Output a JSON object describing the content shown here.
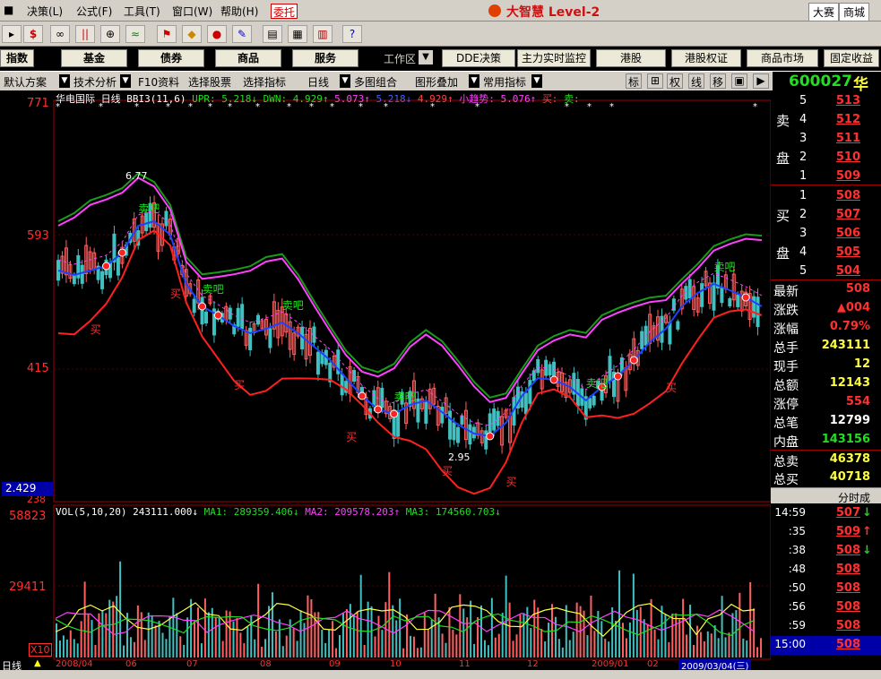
{
  "menu": {
    "items": [
      "决策(L)",
      "公式(F)",
      "工具(T)",
      "窗口(W)",
      "帮助(H)"
    ],
    "entrust": "委托",
    "app_title": "大智慧 Level-2",
    "right_btns": [
      "大赛",
      "商城"
    ]
  },
  "toolbar": {
    "icons": [
      "refresh-icon",
      "dollar-icon",
      "binoculars-icon",
      "barcode-icon",
      "binoculars2-icon",
      "wave-icon",
      "flag-icon",
      "diamond-icon",
      "record-icon",
      "pen-icon",
      "calc-icon",
      "grid-icon",
      "book-icon",
      "help-icon"
    ]
  },
  "nav": {
    "buttons": [
      "指数",
      "基金",
      "债券",
      "商品",
      "服务"
    ],
    "workarea": "工作区",
    "right_buttons": [
      "DDE决策",
      "主力实时监控",
      "港股",
      "港股权证",
      "商品市场",
      "固定收益"
    ]
  },
  "subbar": {
    "items": [
      "默认方案",
      "技术分析",
      "F10资料",
      "选择股票",
      "选择指标",
      "日线",
      "多图组合",
      "图形叠加",
      "常用指标"
    ],
    "mode_buttons": [
      "标",
      "⊞",
      "权",
      "线",
      "移",
      "▣",
      "▶"
    ],
    "code": "600027",
    "name_part": "华"
  },
  "chart_header": {
    "stock": "华电国际",
    "period": "日线",
    "indicator": "BBI3(11,6)",
    "upr": "UPR: 5.218↓",
    "dwn": "DWN: 4.929↑",
    "v1": "5.073↑",
    "v2": "5.218↓",
    "v3": "4.929↑",
    "trend": "小趋势: 5.076↑",
    "buy": "买:",
    "sell": "卖:"
  },
  "price_axis": {
    "labels": [
      "771",
      "593",
      "415",
      "238"
    ],
    "current": "2.429"
  },
  "price_annotations": {
    "high": "6.77",
    "low": "2.95"
  },
  "signals": {
    "buy": "买",
    "sell": "卖吧"
  },
  "vol_header": {
    "label": "VOL(5,10,20)",
    "vol": "243111.000↓",
    "ma1": "MA1: 289359.406↓",
    "ma2": "MA2: 209578.203↑",
    "ma3": "MA3: 174560.703↓"
  },
  "vol_axis": {
    "labels": [
      "58823",
      "29411"
    ],
    "scale": "X10"
  },
  "date_axis": {
    "labels": [
      "2008/04",
      "06",
      "07",
      "08",
      "09",
      "10",
      "11",
      "12",
      "2009/01",
      "02"
    ],
    "current": "2009/03/04(三)",
    "period_btn": "日线"
  },
  "orderbook": {
    "sell_label": [
      "卖",
      "盘"
    ],
    "buy_label": [
      "买",
      "盘"
    ],
    "sells": [
      {
        "n": "5",
        "p": "513"
      },
      {
        "n": "4",
        "p": "512"
      },
      {
        "n": "3",
        "p": "511"
      },
      {
        "n": "2",
        "p": "510"
      },
      {
        "n": "1",
        "p": "509"
      }
    ],
    "buys": [
      {
        "n": "1",
        "p": "508"
      },
      {
        "n": "2",
        "p": "507"
      },
      {
        "n": "3",
        "p": "506"
      },
      {
        "n": "4",
        "p": "505"
      },
      {
        "n": "5",
        "p": "504"
      }
    ]
  },
  "quote": [
    {
      "label": "最新",
      "value": "508",
      "color": "#ff3030"
    },
    {
      "label": "涨跌",
      "value": "▲004",
      "color": "#ff3030"
    },
    {
      "label": "涨幅",
      "value": "0.79%",
      "color": "#ff3030"
    },
    {
      "label": "总手",
      "value": "243111",
      "color": "#ffff40"
    },
    {
      "label": "现手",
      "value": "12",
      "color": "#ffff40"
    },
    {
      "label": "总额",
      "value": "12143",
      "color": "#ffff40"
    },
    {
      "label": "涨停",
      "value": "554",
      "color": "#ff3030"
    },
    {
      "label": "总笔",
      "value": "12799",
      "color": "#ffffff"
    },
    {
      "label": "内盘",
      "value": "143156",
      "color": "#22dd22"
    },
    {
      "label": "总卖",
      "value": "46378",
      "color": "#ffff40"
    },
    {
      "label": "总买",
      "value": "40718",
      "color": "#ffff40"
    }
  ],
  "ticks_title": "分时成",
  "ticks": [
    {
      "t": "14:59",
      "p": "507",
      "ar": "↓"
    },
    {
      "t": ":35",
      "p": "509",
      "ar": "↑"
    },
    {
      "t": ":38",
      "p": "508",
      "ar": "↓"
    },
    {
      "t": ":48",
      "p": "508",
      "ar": ""
    },
    {
      "t": ":50",
      "p": "508",
      "ar": ""
    },
    {
      "t": ":56",
      "p": "508",
      "ar": ""
    },
    {
      "t": ":59",
      "p": "508",
      "ar": ""
    },
    {
      "t": "15:00",
      "p": "508",
      "ar": ""
    }
  ],
  "colors": {
    "up": "#ff3030",
    "down": "#22cc22",
    "upr": "#ff40ff",
    "mid": "#ff4040",
    "dwn": "#2040ff",
    "green": "#1a9a1a"
  }
}
